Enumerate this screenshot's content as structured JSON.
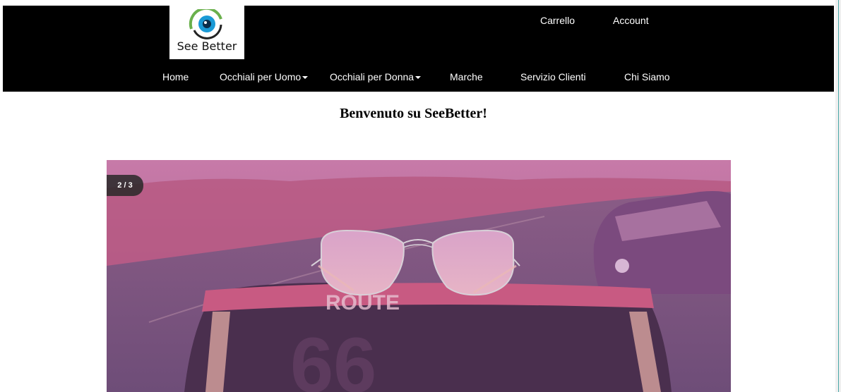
{
  "header": {
    "logo_text": "See Better",
    "top_links": [
      "Carrello",
      "Account"
    ]
  },
  "nav": {
    "items": [
      {
        "label": "Home",
        "dropdown": false
      },
      {
        "label": "Occhiali per Uomo",
        "dropdown": true
      },
      {
        "label": "Occhiali per Donna",
        "dropdown": true
      },
      {
        "label": "Marche",
        "dropdown": false
      },
      {
        "label": "Servizio Clienti",
        "dropdown": false
      },
      {
        "label": "Chi Siamo",
        "dropdown": false
      }
    ]
  },
  "main": {
    "welcome": "Benvenuto su SeeBetter!"
  },
  "slideshow": {
    "counter": "2 / 3",
    "current": 2,
    "total": 3
  },
  "colors": {
    "header_bg": "#000000",
    "nav_text": "#ffffff",
    "accent_eye": "#1a9ad6",
    "accent_green": "#6ab04c"
  }
}
